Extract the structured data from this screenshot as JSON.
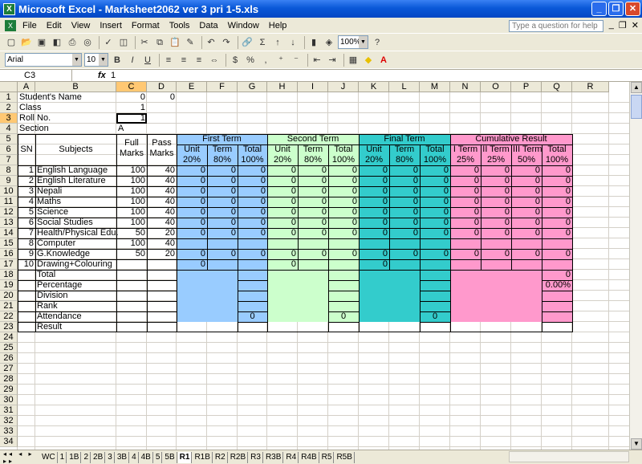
{
  "window": {
    "title": "Microsoft Excel - Marksheet2062 ver 3 pri 1-5.xls"
  },
  "menu": [
    "File",
    "Edit",
    "View",
    "Insert",
    "Format",
    "Tools",
    "Data",
    "Window",
    "Help"
  ],
  "help_placeholder": "Type a question for help",
  "toolbar": {
    "zoom": "100%",
    "font": "Arial",
    "size": "10"
  },
  "formula": {
    "cell": "C3",
    "fx": "fx",
    "value": "1"
  },
  "columns": [
    "A",
    "B",
    "C",
    "D",
    "E",
    "F",
    "G",
    "H",
    "I",
    "J",
    "K",
    "L",
    "M",
    "N",
    "O",
    "P",
    "Q",
    "R"
  ],
  "rows": [
    "1",
    "2",
    "3",
    "4",
    "5",
    "6",
    "7",
    "8",
    "9",
    "10",
    "11",
    "12",
    "13",
    "14",
    "15",
    "16",
    "17",
    "18",
    "19",
    "20",
    "21",
    "22",
    "23",
    "24",
    "25",
    "26",
    "27",
    "28",
    "29",
    "30",
    "31",
    "32",
    "33",
    "34"
  ],
  "header": {
    "student_name": "Student's Name",
    "class": "Class",
    "roll_no": "Roll No.",
    "section": "Section",
    "c1": "0",
    "d1": "0",
    "c2": "1",
    "c3": "1",
    "c4": "A"
  },
  "table": {
    "sn": "SN",
    "subjects": "Subjects",
    "full": "Full",
    "marks": "Marks",
    "pass": "Pass",
    "pmarks": "Marks",
    "first_term": "First Term",
    "second_term": "Second Term",
    "final_term": "Final Term",
    "cumulative": "Cumulative Result",
    "unit": "Unit",
    "term": "Term",
    "total": "Total",
    "p20": "20%",
    "p80": "80%",
    "p100": "100%",
    "iterm": "I Term",
    "iiterm": "II Term",
    "iiiterm": "III Term",
    "p25": "25%",
    "p50": "50%"
  },
  "subjects": [
    {
      "sn": "1",
      "name": "English Language",
      "full": "100",
      "pass": "40"
    },
    {
      "sn": "2",
      "name": "English Literature",
      "full": "100",
      "pass": "40"
    },
    {
      "sn": "3",
      "name": "Nepali",
      "full": "100",
      "pass": "40"
    },
    {
      "sn": "4",
      "name": "Maths",
      "full": "100",
      "pass": "40"
    },
    {
      "sn": "5",
      "name": "Science",
      "full": "100",
      "pass": "40"
    },
    {
      "sn": "6",
      "name": "Social Studies",
      "full": "100",
      "pass": "40"
    },
    {
      "sn": "7",
      "name": "Health/Physical Edu.",
      "full": "50",
      "pass": "20"
    },
    {
      "sn": "8",
      "name": "Computer",
      "full": "100",
      "pass": "40"
    },
    {
      "sn": "9",
      "name": "G.Knowledge",
      "full": "50",
      "pass": "20"
    },
    {
      "sn": "10",
      "name": "Drawing+Colouring",
      "full": "",
      "pass": ""
    }
  ],
  "summary": [
    "Total",
    "Percentage",
    "Division",
    "Rank",
    "Attendance",
    "Result"
  ],
  "q18": "0",
  "q19": "0.00%",
  "zero": "0",
  "tabs": [
    "WC",
    "1",
    "1B",
    "2",
    "2B",
    "3",
    "3B",
    "4",
    "4B",
    "5",
    "5B",
    "R1",
    "R1B",
    "R2",
    "R2B",
    "R3",
    "R3B",
    "R4",
    "R4B",
    "R5",
    "R5B"
  ],
  "colors": {
    "first": "#99ccff",
    "second": "#ccffcc",
    "final": "#33cccc",
    "cumulative": "#ff99cc"
  }
}
